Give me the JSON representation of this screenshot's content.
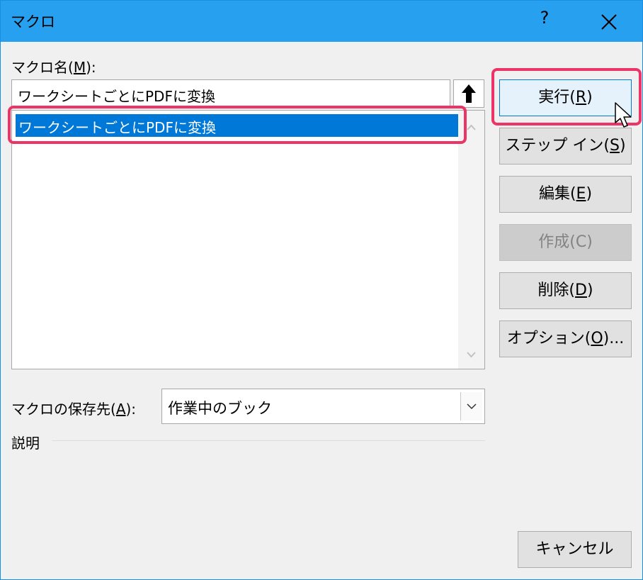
{
  "window": {
    "title": "マクロ",
    "help": "?"
  },
  "macro_name": {
    "label_pre": "マクロ名(",
    "label_key": "M",
    "label_post": "):",
    "value": "ワークシートごとにPDFに変換"
  },
  "macro_list": {
    "items": [
      "ワークシートごとにPDFに変換"
    ]
  },
  "buttons": {
    "run": {
      "pre": "実行(",
      "key": "R",
      "post": ")"
    },
    "step_in": {
      "pre": "ステップ イン(",
      "key": "S",
      "post": ")"
    },
    "edit": {
      "pre": "編集(",
      "key": "E",
      "post": ")"
    },
    "create": {
      "pre": "作成(",
      "key": "C",
      "post": ")"
    },
    "delete": {
      "pre": "削除(",
      "key": "D",
      "post": ")"
    },
    "options": {
      "pre": "オプション(",
      "key": "O",
      "post": ")..."
    },
    "cancel": "キャンセル"
  },
  "store": {
    "label_pre": "マクロの保存先(",
    "label_key": "A",
    "label_post": "):",
    "value": "作業中のブック"
  },
  "description": {
    "label": "説明"
  },
  "colors": {
    "titlebar": "#27a0f0",
    "selection": "#0078d7",
    "highlight": "#ec3467",
    "dialog_bg": "#f0f0f0"
  }
}
